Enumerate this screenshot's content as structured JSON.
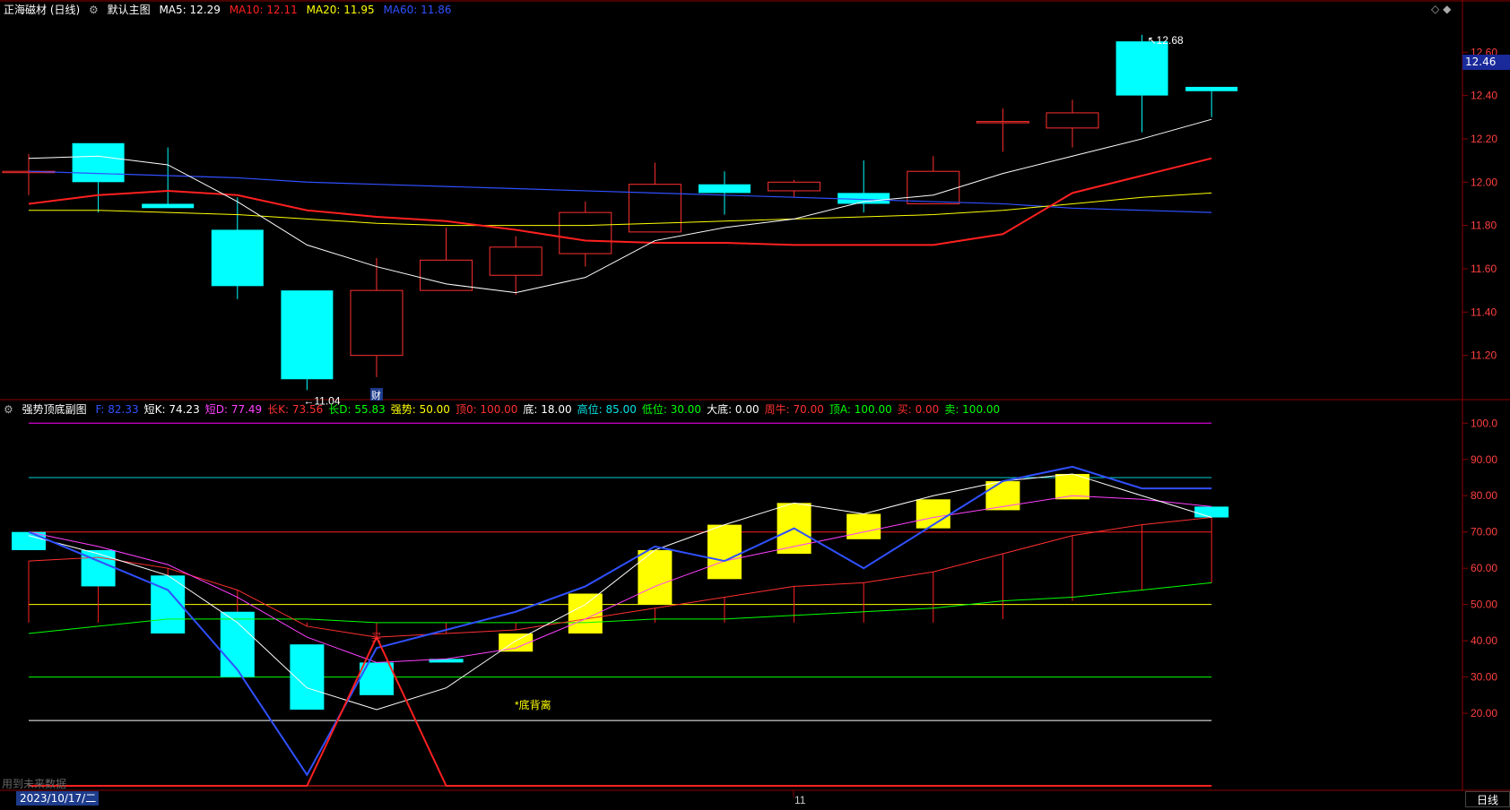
{
  "main_header": {
    "stock": "正海磁材 (日线)",
    "chart_name": "默认主图",
    "ma5": {
      "label": "MA5: 12.29",
      "color": "#ffffff"
    },
    "ma10": {
      "label": "MA10: 12.11",
      "color": "#ff2020"
    },
    "ma20": {
      "label": "MA20: 11.95",
      "color": "#ffff00"
    },
    "ma60": {
      "label": "MA60: 11.86",
      "color": "#3050ff"
    }
  },
  "sub_header": {
    "name": "强势顶底副图",
    "items": [
      {
        "label": "F: 82.33",
        "color": "#3050ff"
      },
      {
        "label": "短K: 74.23",
        "color": "#ffffff"
      },
      {
        "label": "短D: 77.49",
        "color": "#ff40ff"
      },
      {
        "label": "长K: 73.56",
        "color": "#ff3030"
      },
      {
        "label": "长D: 55.83",
        "color": "#00ff00"
      },
      {
        "label": "强势: 50.00",
        "color": "#ffff00"
      },
      {
        "label": "顶0: 100.00",
        "color": "#ff3030"
      },
      {
        "label": "底: 18.00",
        "color": "#ffffff"
      },
      {
        "label": "高位: 85.00",
        "color": "#00e5e5"
      },
      {
        "label": "低位: 30.00",
        "color": "#00ff00"
      },
      {
        "label": "大底: 0.00",
        "color": "#ffffff"
      },
      {
        "label": "周牛: 70.00",
        "color": "#ff3030"
      },
      {
        "label": "顶A: 100.00",
        "color": "#00ff00"
      },
      {
        "label": "买: 0.00",
        "color": "#ff3030"
      },
      {
        "label": "卖: 100.00",
        "color": "#00ff00"
      }
    ]
  },
  "price_axis": {
    "ticks": [
      "12.60",
      "12.40",
      "12.20",
      "12.00",
      "11.80",
      "11.60",
      "11.40",
      "11.20"
    ],
    "range": [
      11.0,
      12.75
    ]
  },
  "indicator_axis": {
    "ticks": [
      "100.0",
      "90.00",
      "80.00",
      "70.00",
      "60.00",
      "50.00",
      "40.00",
      "30.00",
      "20.00"
    ],
    "range": [
      0,
      100
    ]
  },
  "current_price": "12.46",
  "annotations": {
    "high": "12.68",
    "low": "11.04",
    "finance_marker": "财",
    "divergence": "*底背离",
    "buy_marker": "买",
    "month_label": "11"
  },
  "footer": {
    "date": "2023/10/17/二",
    "period": "日线",
    "future_data": "用到未来数据"
  },
  "colors": {
    "up": "#ff3030",
    "down": "#00ffff",
    "grid": "#8b0000",
    "axis_text": "#ff4040",
    "sub_up": "#ffff00"
  },
  "chart_data": {
    "type": "candlestick",
    "candles": [
      {
        "o": 12.05,
        "c": 12.05,
        "h": 12.13,
        "l": 11.94
      },
      {
        "o": 12.18,
        "c": 12.0,
        "h": 12.18,
        "l": 11.86
      },
      {
        "o": 11.9,
        "c": 11.88,
        "h": 12.16,
        "l": 11.88
      },
      {
        "o": 11.78,
        "c": 11.52,
        "h": 11.93,
        "l": 11.46
      },
      {
        "o": 11.5,
        "c": 11.09,
        "h": 11.5,
        "l": 11.04
      },
      {
        "o": 11.2,
        "c": 11.5,
        "h": 11.65,
        "l": 11.1
      },
      {
        "o": 11.5,
        "c": 11.64,
        "h": 11.79,
        "l": 11.5
      },
      {
        "o": 11.57,
        "c": 11.7,
        "h": 11.75,
        "l": 11.48
      },
      {
        "o": 11.67,
        "c": 11.86,
        "h": 11.91,
        "l": 11.61
      },
      {
        "o": 11.77,
        "c": 11.99,
        "h": 12.09,
        "l": 11.77
      },
      {
        "o": 11.99,
        "c": 11.95,
        "h": 12.05,
        "l": 11.85
      },
      {
        "o": 11.96,
        "c": 12.0,
        "h": 12.01,
        "l": 11.93
      },
      {
        "o": 11.95,
        "c": 11.9,
        "h": 12.1,
        "l": 11.86
      },
      {
        "o": 11.9,
        "c": 12.05,
        "h": 12.12,
        "l": 11.9
      },
      {
        "o": 12.28,
        "c": 12.28,
        "h": 12.34,
        "l": 12.14
      },
      {
        "o": 12.25,
        "c": 12.32,
        "h": 12.38,
        "l": 12.16
      },
      {
        "o": 12.65,
        "c": 12.4,
        "h": 12.68,
        "l": 12.23
      },
      {
        "o": 12.44,
        "c": 12.42,
        "h": 12.44,
        "l": 12.3
      }
    ],
    "ma5": [
      12.11,
      12.12,
      12.08,
      11.91,
      11.71,
      11.61,
      11.53,
      11.49,
      11.56,
      11.73,
      11.79,
      11.83,
      11.91,
      11.94,
      12.04,
      12.12,
      12.2,
      12.29
    ],
    "ma10": [
      11.9,
      11.94,
      11.96,
      11.94,
      11.87,
      11.84,
      11.82,
      11.78,
      11.73,
      11.72,
      11.72,
      11.71,
      11.71,
      11.71,
      11.76,
      11.95,
      12.03,
      12.11
    ],
    "ma20": [
      11.87,
      11.87,
      11.86,
      11.85,
      11.83,
      11.81,
      11.8,
      11.8,
      11.8,
      11.81,
      11.82,
      11.83,
      11.84,
      11.85,
      11.87,
      11.9,
      11.93,
      11.95
    ],
    "ma60": [
      12.05,
      12.04,
      12.03,
      12.02,
      12.0,
      11.99,
      11.98,
      11.97,
      11.96,
      11.95,
      11.94,
      11.93,
      11.92,
      11.91,
      11.9,
      11.88,
      11.87,
      11.86
    ],
    "indicator": {
      "boxes": [
        {
          "t": 70,
          "b": 65,
          "up": false
        },
        {
          "t": 65,
          "b": 55,
          "up": false
        },
        {
          "t": 58,
          "b": 42,
          "up": false
        },
        {
          "t": 48,
          "b": 30,
          "up": false
        },
        {
          "t": 39,
          "b": 21,
          "up": false
        },
        {
          "t": 34,
          "b": 25,
          "up": false
        },
        {
          "t": 35,
          "b": 34,
          "up": false
        },
        {
          "t": 42,
          "b": 37,
          "up": true
        },
        {
          "t": 53,
          "b": 42,
          "up": true
        },
        {
          "t": 65,
          "b": 50,
          "up": true
        },
        {
          "t": 72,
          "b": 57,
          "up": true
        },
        {
          "t": 78,
          "b": 64,
          "up": true
        },
        {
          "t": 75,
          "b": 68,
          "up": true
        },
        {
          "t": 79,
          "b": 71,
          "up": true
        },
        {
          "t": 84,
          "b": 76,
          "up": true
        },
        {
          "t": 86,
          "b": 79,
          "up": true
        },
        {
          "t": 0,
          "b": 0,
          "up": true
        },
        {
          "t": 77,
          "b": 74,
          "up": false
        }
      ],
      "short_k": [
        69,
        64,
        58,
        45,
        27,
        21,
        27,
        40,
        50,
        65,
        72,
        78,
        75,
        80,
        84,
        86,
        80,
        74
      ],
      "short_d": [
        70,
        66,
        61,
        52,
        41,
        34,
        35,
        38,
        46,
        55,
        62,
        66,
        70,
        74,
        77,
        80,
        79,
        77
      ],
      "long_k": [
        62,
        63,
        60,
        54,
        44,
        41,
        42,
        43,
        46,
        49,
        52,
        55,
        56,
        59,
        64,
        69,
        72,
        74
      ],
      "long_d": [
        42,
        44,
        46,
        46,
        46,
        45,
        45,
        45,
        45,
        46,
        46,
        47,
        48,
        49,
        51,
        52,
        54,
        56
      ],
      "f": [
        70,
        62,
        54,
        32,
        3,
        38,
        43,
        48,
        55,
        66,
        62,
        71,
        60,
        72,
        84,
        88,
        82,
        82
      ],
      "buy": [
        0,
        0,
        0,
        0,
        0,
        41,
        0,
        0,
        0,
        0,
        0,
        0,
        0,
        0,
        0,
        0,
        0,
        0
      ]
    }
  }
}
